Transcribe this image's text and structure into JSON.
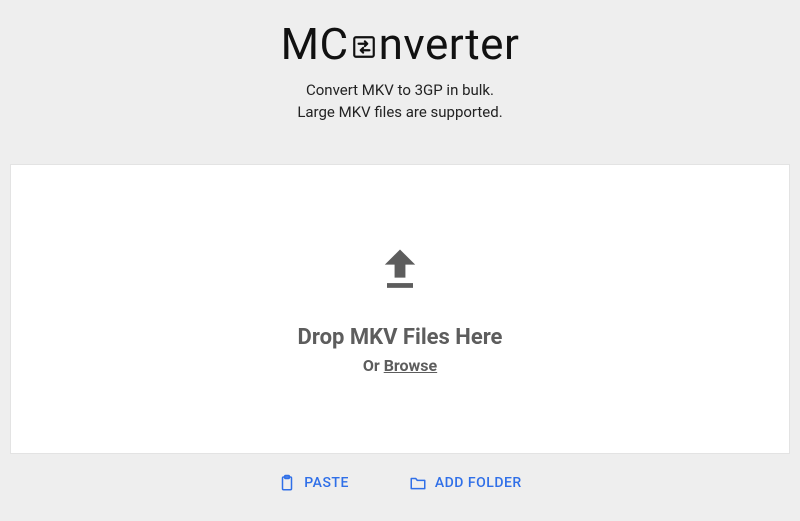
{
  "logo": {
    "part1": "MC",
    "part2": "nverter"
  },
  "tagline": {
    "line1": "Convert MKV to 3GP in bulk.",
    "line2": "Large MKV files are supported."
  },
  "dropzone": {
    "title": "Drop MKV Files Here",
    "or_prefix": "Or ",
    "browse_label": "Browse"
  },
  "actions": {
    "paste_label": "PASTE",
    "add_folder_label": "ADD FOLDER"
  },
  "colors": {
    "accent": "#2f6fe8",
    "muted": "#5d5d5d",
    "bg": "#eeeeee",
    "panel": "#ffffff"
  }
}
